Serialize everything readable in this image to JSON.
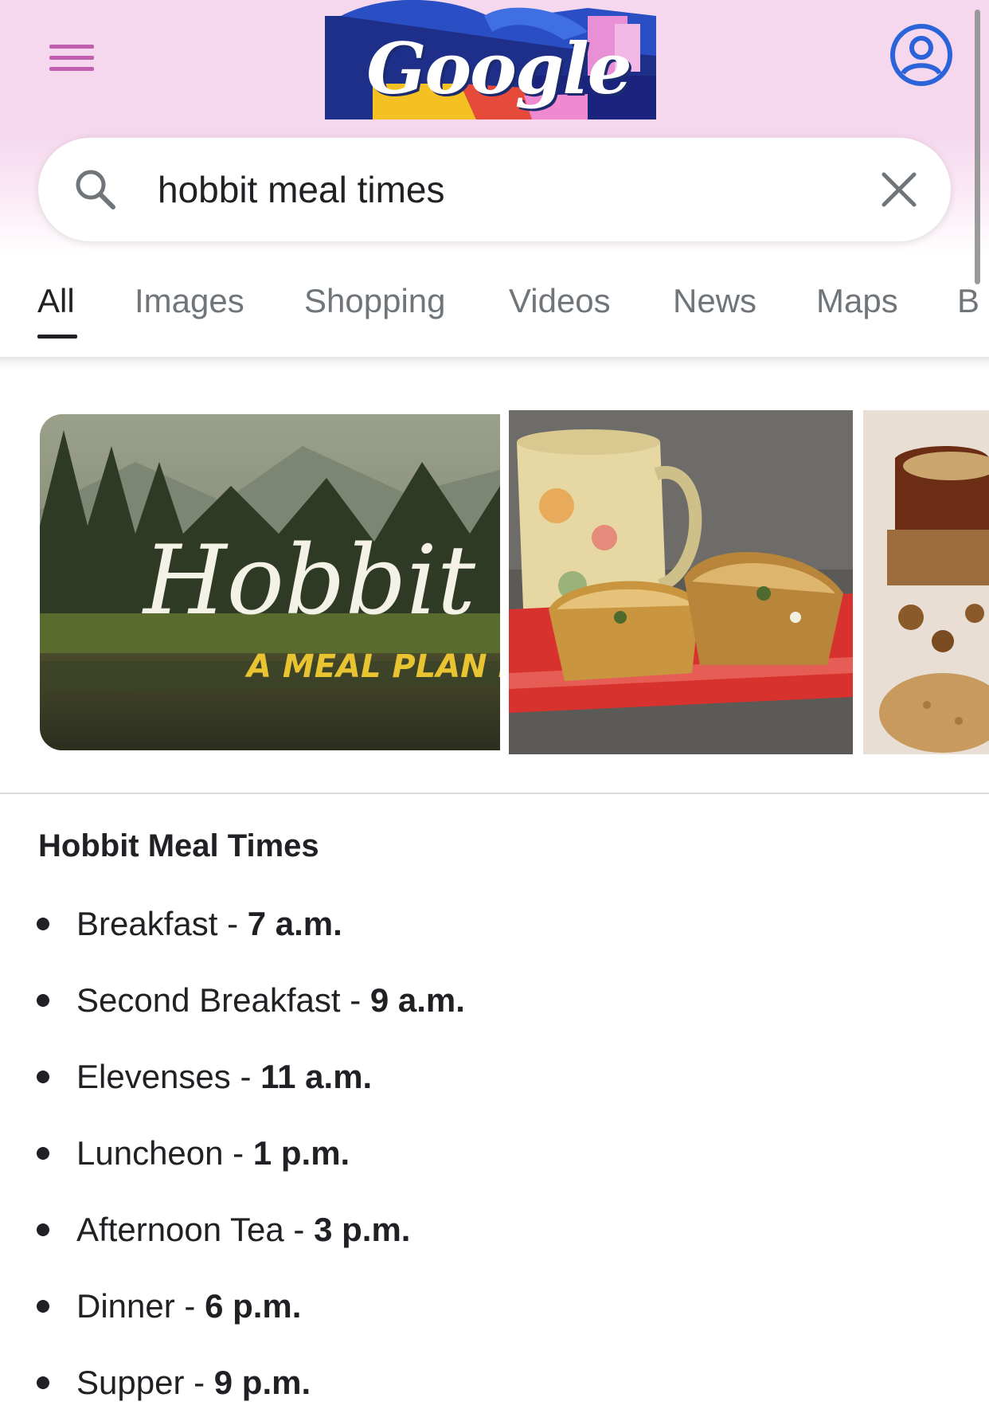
{
  "header": {
    "doodle_text": "Google",
    "menu_icon": "hamburger-menu-icon",
    "account_icon": "account-circle-icon",
    "account_color": "#2b63d9",
    "menu_color": "#c05fb0"
  },
  "search": {
    "query": "hobbit meal times",
    "search_icon": "search-icon",
    "clear_icon": "close-icon"
  },
  "tabs": [
    {
      "label": "All",
      "active": true
    },
    {
      "label": "Images"
    },
    {
      "label": "Shopping"
    },
    {
      "label": "Videos"
    },
    {
      "label": "News"
    },
    {
      "label": "Maps"
    },
    {
      "label": "B"
    }
  ],
  "images": {
    "image1_title": "Hobbit",
    "image1_subtitle": "A MEAL PLAN FOR MI"
  },
  "featured": {
    "title": "Hobbit Meal Times",
    "items": [
      {
        "name": "Breakfast",
        "sep": " - ",
        "time": "7 a.m."
      },
      {
        "name": "Second Breakfast",
        "sep": " - ",
        "time": "9 a.m."
      },
      {
        "name": "Elevenses",
        "sep": " - ",
        "time": "11 a.m."
      },
      {
        "name": "Luncheon",
        "sep": " - ",
        "time": "1 p.m."
      },
      {
        "name": "Afternoon Tea",
        "sep": " - ",
        "time": "3 p.m."
      },
      {
        "name": "Dinner",
        "sep": " - ",
        "time": "6 p.m."
      },
      {
        "name": "Supper",
        "sep": " - ",
        "time": "9 p.m."
      }
    ]
  }
}
